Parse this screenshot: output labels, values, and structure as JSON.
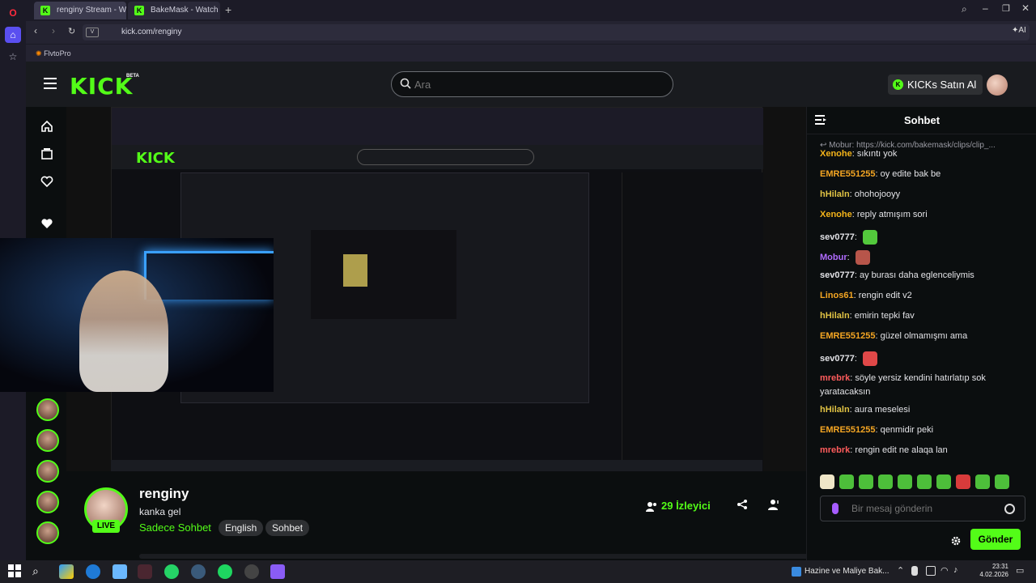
{
  "browser": {
    "tabs": [
      {
        "label": "renginy Stream - Watch L"
      },
      {
        "label": "BakeMask - Watch clips o"
      }
    ],
    "url": "kick.com/renginy",
    "ai_label": "AI",
    "bookmark": "FlvtoPro"
  },
  "header": {
    "logo": "KICK",
    "beta": "BETA",
    "search_placeholder": "Ara",
    "kicks_button": "KICKs Satın Al"
  },
  "stream": {
    "channel": "renginy",
    "title": "kanka gel",
    "category": "Sadece Sohbet",
    "tags": [
      "English",
      "Sohbet"
    ],
    "live_label": "LIVE",
    "viewers": "29 İzleyici"
  },
  "chat": {
    "title": "Sohbet",
    "reply_text": "Mobur: https://kick.com/bakemask/clips/clip_...",
    "messages": [
      {
        "user": "Xenohe",
        "color": "#f4b41a",
        "text": "sıkıntı yok"
      },
      {
        "user": "EMRE551255",
        "color": "#f5a623",
        "text": "oy edite bak be"
      },
      {
        "user": "hHilaln",
        "color": "#e0c244",
        "text": "ohohojooyy"
      },
      {
        "user": "Xenohe",
        "color": "#f4b41a",
        "text": "reply atmışım sori"
      },
      {
        "user": "sev0777",
        "color": "#e3e3e7",
        "text": ""
      },
      {
        "user": "Mobur",
        "color": "#b16cff",
        "text": ""
      },
      {
        "user": "sev0777",
        "color": "#e3e3e7",
        "text": "ay burası daha eglenceliymis"
      },
      {
        "user": "Linos61",
        "color": "#f5a623",
        "text": "rengin edit v2"
      },
      {
        "user": "hHilaln",
        "color": "#e0c244",
        "text": "emirin tepki fav"
      },
      {
        "user": "EMRE551255",
        "color": "#f5a623",
        "text": "güzel olmamışmı ama"
      },
      {
        "user": "sev0777",
        "color": "#e3e3e7",
        "text": ""
      },
      {
        "user": "mrebrk",
        "color": "#ff5c5c",
        "text": "söyle yersiz kendini hatırlatıp sok yaratacaksın"
      },
      {
        "user": "hHilaln",
        "color": "#e0c244",
        "text": "aura meselesi"
      },
      {
        "user": "EMRE551255",
        "color": "#f5a623",
        "text": "qenmidir peki"
      },
      {
        "user": "mrebrk",
        "color": "#ff5c5c",
        "text": "rengin edit ne alaqa lan"
      }
    ],
    "input_placeholder": "Bir mesaj gönderin",
    "send_button": "Gönder"
  },
  "taskbar": {
    "app_label": "Hazine ve Maliye Bak...",
    "time": "23:31",
    "date": "4.02.2026"
  },
  "colors": {
    "accent": "#53fc18",
    "background": "#0b0e0f"
  }
}
